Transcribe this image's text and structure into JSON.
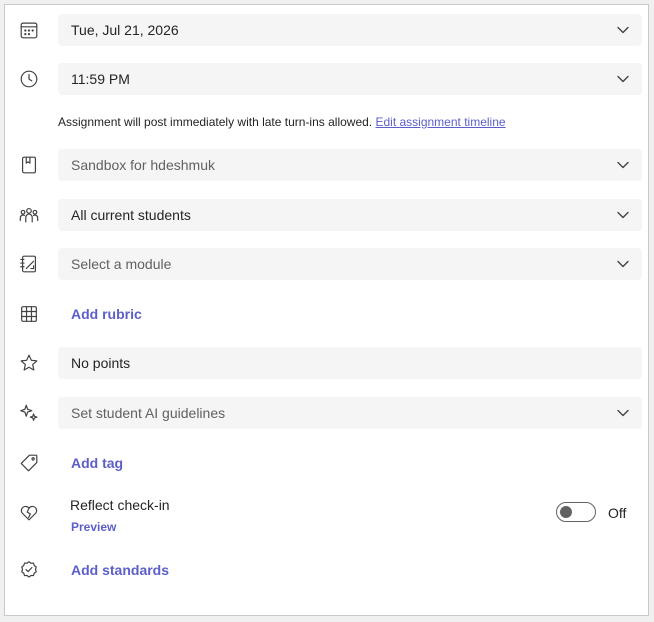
{
  "date": {
    "value": "Tue, Jul 21, 2026"
  },
  "time": {
    "value": "11:59 PM"
  },
  "notice": {
    "text": "Assignment will post immediately with late turn-ins allowed.",
    "link": "Edit assignment timeline"
  },
  "class": {
    "value": "Sandbox for hdeshmuk"
  },
  "students": {
    "value": "All current students"
  },
  "module": {
    "placeholder": "Select a module"
  },
  "rubric": {
    "label": "Add rubric"
  },
  "points": {
    "value": "No points"
  },
  "ai": {
    "placeholder": "Set student AI guidelines"
  },
  "tag": {
    "label": "Add tag"
  },
  "reflect": {
    "title": "Reflect check-in",
    "preview": "Preview",
    "toggle_state": "Off",
    "enabled": false
  },
  "standards": {
    "label": "Add standards"
  },
  "colors": {
    "accent": "#5b5fc7",
    "field_bg": "#f5f5f5",
    "text": "#242424"
  }
}
